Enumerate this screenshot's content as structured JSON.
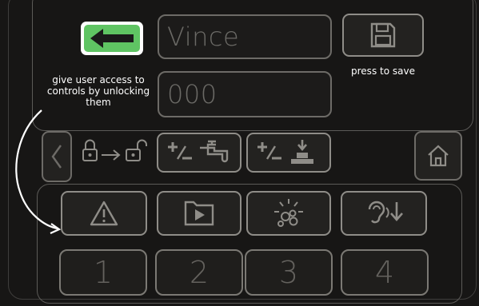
{
  "name_field": {
    "value": "Vince"
  },
  "code_field": {
    "value": "000"
  },
  "save": {
    "hint": "press to save"
  },
  "annotation": {
    "text_lines": [
      "give user access to",
      "controls by unlocking",
      "them"
    ]
  },
  "number_buttons": [
    "1",
    "2",
    "3",
    "4"
  ],
  "colors": {
    "accent_green": "#5fc463",
    "background": "#171615",
    "outline": "#8f8d88",
    "dim_text": "#6b6a66"
  },
  "icons": {
    "back": "left-arrow-icon",
    "save": "floppy-disk-icon",
    "prev": "chevron-left-icon",
    "lock": "lock-to-unlock-icon",
    "tap": "plus-minus-tap-icon",
    "dispense": "plus-minus-dispense-icon",
    "home": "home-icon",
    "warning": "warning-icon",
    "media": "play-folder-icon",
    "light": "light-bubbles-icon",
    "hearing": "hearing-volume-down-icon"
  }
}
